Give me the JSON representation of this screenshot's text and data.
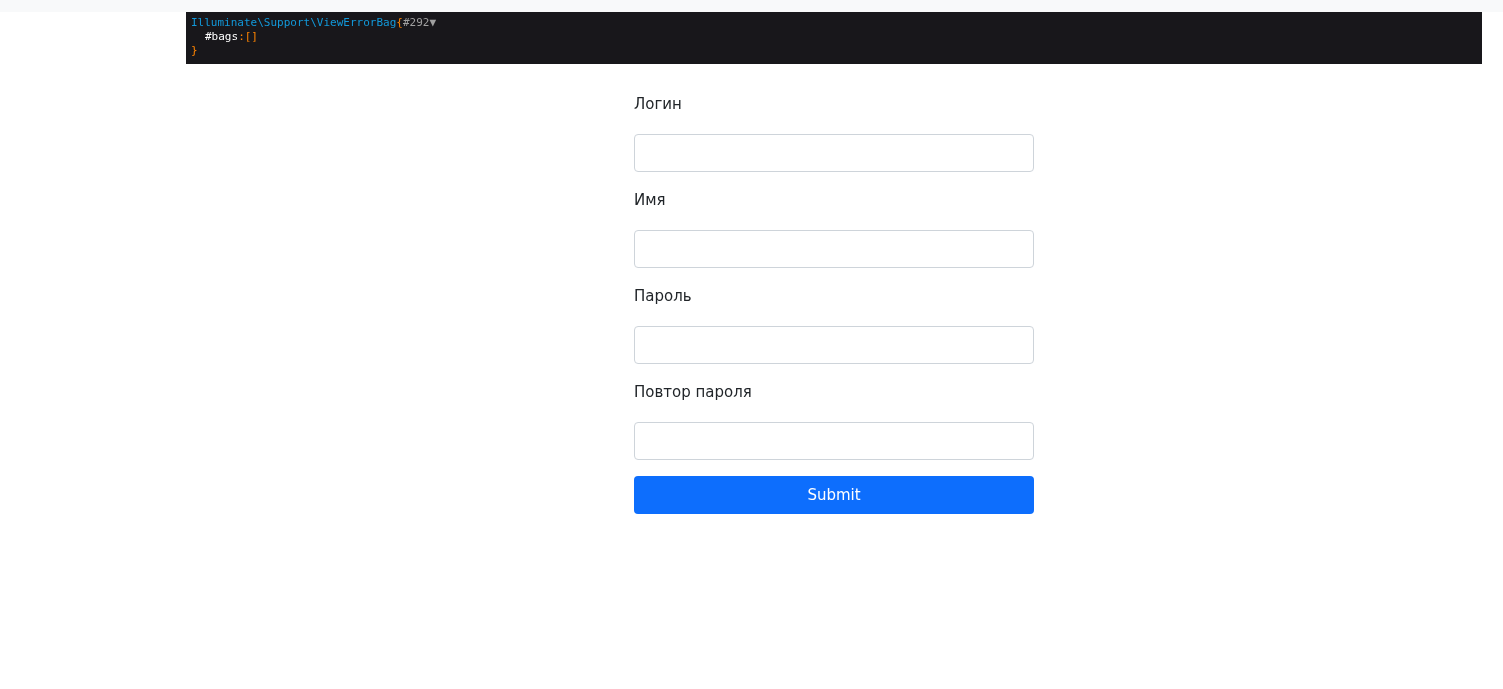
{
  "dump": {
    "class_name": "Illuminate\\Support\\ViewErrorBag",
    "open_brace": "{",
    "object_id": "#292",
    "toggle": "▼",
    "property": {
      "name": "#bags",
      "separator": ":",
      "value": "[]"
    },
    "close_brace": "}"
  },
  "fields": [
    {
      "label": "Логин"
    },
    {
      "label": "Имя"
    },
    {
      "label": "Пароль"
    },
    {
      "label": "Повтор пароля"
    }
  ],
  "submit": "Submit"
}
